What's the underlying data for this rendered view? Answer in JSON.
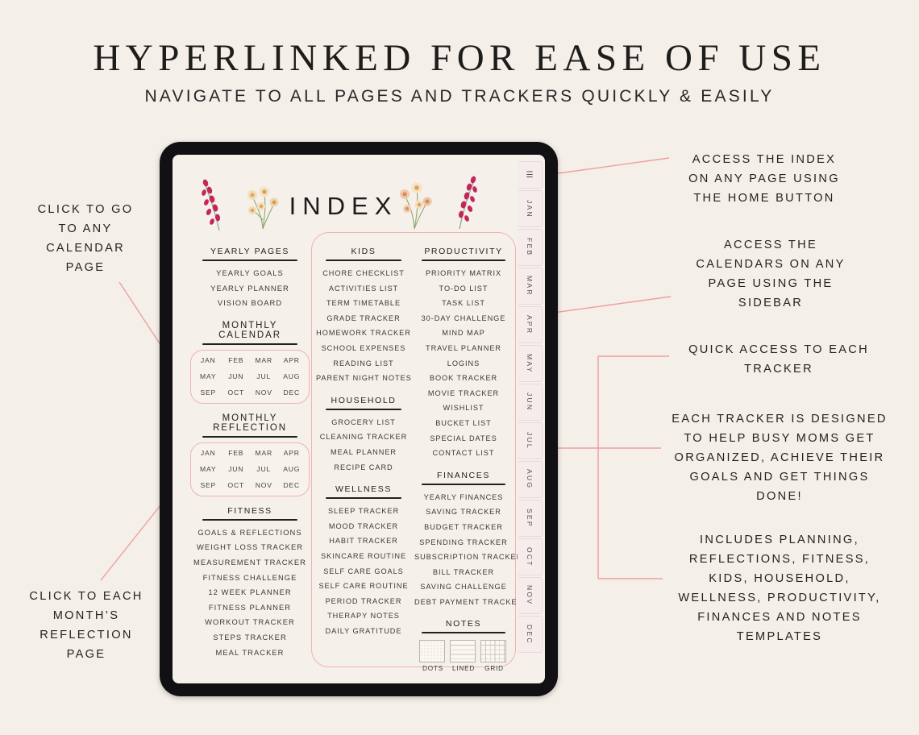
{
  "header": {
    "title": "HYPERLINKED FOR EASE OF USE",
    "subtitle": "NAVIGATE TO ALL PAGES AND TRACKERS QUICKLY & EASILY"
  },
  "tablet": {
    "page_title": "INDEX"
  },
  "index": {
    "left_column": [
      {
        "id": "yearly-pages",
        "heading": "YEARLY PAGES",
        "items": [
          "YEARLY GOALS",
          "YEARLY PLANNER",
          "VISION BOARD"
        ]
      },
      {
        "id": "monthly-calendar",
        "heading": "MONTHLY CALENDAR",
        "months": [
          "JAN",
          "FEB",
          "MAR",
          "APR",
          "MAY",
          "JUN",
          "JUL",
          "AUG",
          "SEP",
          "OCT",
          "NOV",
          "DEC"
        ]
      },
      {
        "id": "monthly-reflection",
        "heading": "MONTHLY REFLECTION",
        "months": [
          "JAN",
          "FEB",
          "MAR",
          "APR",
          "MAY",
          "JUN",
          "JUL",
          "AUG",
          "SEP",
          "OCT",
          "NOV",
          "DEC"
        ]
      },
      {
        "id": "fitness",
        "heading": "FITNESS",
        "items": [
          "GOALS & REFLECTIONS",
          "WEIGHT LOSS TRACKER",
          "MEASUREMENT TRACKER",
          "FITNESS CHALLENGE",
          "12 WEEK PLANNER",
          "FITNESS PLANNER",
          "WORKOUT TRACKER",
          "STEPS TRACKER",
          "MEAL TRACKER"
        ]
      }
    ],
    "middle_column": [
      {
        "id": "kids",
        "heading": "KIDS",
        "items": [
          "CHORE CHECKLIST",
          "ACTIVITIES LIST",
          "TERM TIMETABLE",
          "GRADE TRACKER",
          "HOMEWORK TRACKER",
          "SCHOOL EXPENSES",
          "READING LIST",
          "PARENT NIGHT NOTES"
        ]
      },
      {
        "id": "household",
        "heading": "HOUSEHOLD",
        "items": [
          "GROCERY LIST",
          "CLEANING TRACKER",
          "MEAL PLANNER",
          "RECIPE CARD"
        ]
      },
      {
        "id": "wellness",
        "heading": "WELLNESS",
        "items": [
          "SLEEP TRACKER",
          "MOOD TRACKER",
          "HABIT TRACKER",
          "SKINCARE ROUTINE",
          "SELF CARE GOALS",
          "SELF CARE ROUTINE",
          "PERIOD TRACKER",
          "THERAPY NOTES",
          "DAILY GRATITUDE"
        ]
      }
    ],
    "right_column": [
      {
        "id": "productivity",
        "heading": "PRODUCTIVITY",
        "items": [
          "PRIORITY MATRIX",
          "TO-DO LIST",
          "TASK LIST",
          "30-DAY CHALLENGE",
          "MIND MAP",
          "TRAVEL PLANNER",
          "LOGINS",
          "BOOK TRACKER",
          "MOVIE TRACKER",
          "WISHLIST",
          "BUCKET LIST",
          "SPECIAL DATES",
          "CONTACT LIST"
        ]
      },
      {
        "id": "finances",
        "heading": "FINANCES",
        "items": [
          "YEARLY FINANCES",
          "SAVING TRACKER",
          "BUDGET TRACKER",
          "SPENDING TRACKER",
          "SUBSCRIPTION TRACKER",
          "BILL TRACKER",
          "SAVING CHALLENGE",
          "DEBT PAYMENT TRACKER"
        ]
      },
      {
        "id": "notes",
        "heading": "NOTES",
        "paper_types": [
          "DOTS",
          "LINED",
          "GRID"
        ]
      }
    ]
  },
  "sidebar": {
    "home_label": "☰",
    "home_icon": "hamburger-home-icon",
    "tabs": [
      "JAN",
      "FEB",
      "MAR",
      "APR",
      "MAY",
      "JUN",
      "JUL",
      "AUG",
      "SEP",
      "OCT",
      "NOV",
      "DEC"
    ]
  },
  "annotations": {
    "left": [
      "CLICK TO GO\nTO ANY\nCALENDAR\nPAGE",
      "CLICK TO EACH\nMONTH’S\nREFLECTION\nPAGE"
    ],
    "right": [
      "ACCESS THE INDEX\nON ANY PAGE USING\nTHE HOME BUTTON",
      "ACCESS THE\nCALENDARS ON ANY\nPAGE USING THE\nSIDEBAR",
      "QUICK ACCESS TO EACH\nTRACKER",
      "EACH TRACKER IS DESIGNED\nTO HELP BUSY MOMS GET\nORGANIZED, ACHIEVE THEIR\nGOALS AND GET THINGS\nDONE!",
      "INCLUDES PLANNING,\nREFLECTIONS, FITNESS,\nKIDS, HOUSEHOLD,\nWELLNESS, PRODUCTIVITY,\nFINANCES AND NOTES\nTEMPLATES"
    ]
  },
  "colors": {
    "background": "#f4efe8",
    "page": "#f5f0ea",
    "bezel": "#111113",
    "accent_pink": "#efb2b2",
    "text": "#232323"
  }
}
